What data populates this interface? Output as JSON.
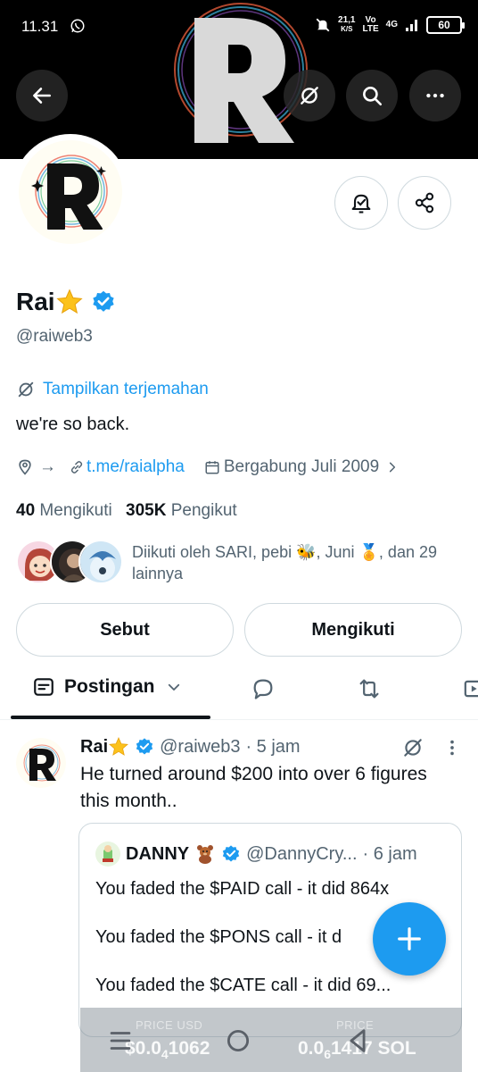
{
  "status_bar": {
    "time": "11.31",
    "speed_value": "21,1",
    "speed_unit": "K/S",
    "vo_top": "Vo",
    "vo_bottom": "LTE",
    "network": "4G",
    "battery": "60"
  },
  "profile": {
    "name": "Rai",
    "handle": "@raiweb3",
    "translate_label": "Tampilkan terjemahan",
    "bio": "we're so back.",
    "location_text": "→",
    "link": "t.me/raialpha",
    "joined": "Bergabung Juli 2009",
    "following_count": "40",
    "following_label": "Mengikuti",
    "followers_count": "305K",
    "followers_label": "Pengikut",
    "followed_by": "Diikuti oleh SARI, pebi 🐝, Juni 🏅, dan 29 lainnya"
  },
  "actions": {
    "mention_label": "Sebut",
    "following_label": "Mengikuti"
  },
  "tabs": {
    "active_label": "Postingan"
  },
  "post": {
    "name": "Rai",
    "handle": "@raiweb3",
    "time": "· 5 jam",
    "text": "He turned around $200 into over 6 figures this month..",
    "quote": {
      "name": "DANNY",
      "handle": "@DannyCry...",
      "time": "· 6 jam",
      "line1": "You faded the $PAID call - it did 864x",
      "line2": "You faded the $PONS call - it d",
      "line3": "You faded the $CATE call - it did 69..."
    }
  },
  "price_overlay": {
    "left_label": "PRICE USD",
    "left_value_a": "$0.0",
    "left_value_sub": "4",
    "left_value_b": "1062",
    "right_label": "PRICE",
    "right_value_a": "0.0",
    "right_value_sub": "6",
    "right_value_b": "1417 SOL"
  },
  "colors": {
    "accent": "#1d9bf0",
    "text": "#0f1419",
    "muted": "#536471",
    "border": "#cfd9de"
  }
}
